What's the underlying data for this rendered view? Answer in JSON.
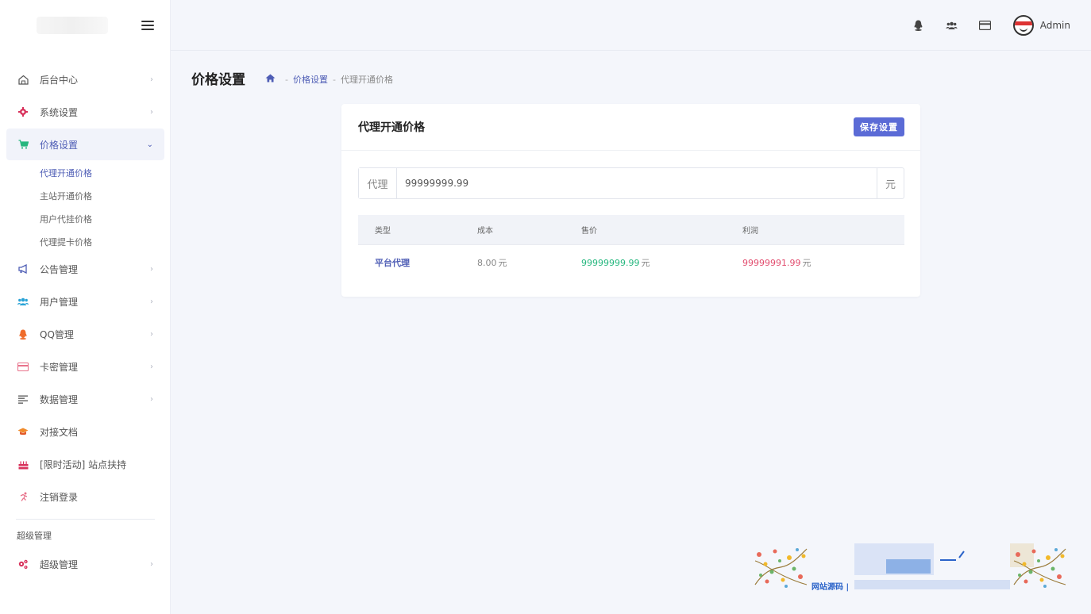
{
  "header": {
    "admin_name": "Admin"
  },
  "sidebar": {
    "items": [
      {
        "label": "后台中心",
        "icon": "home-icon"
      },
      {
        "label": "系统设置",
        "icon": "gear-icon"
      },
      {
        "label": "价格设置",
        "icon": "cart-icon",
        "active": true
      },
      {
        "label": "公告管理",
        "icon": "megaphone-icon"
      },
      {
        "label": "用户管理",
        "icon": "users-icon"
      },
      {
        "label": "QQ管理",
        "icon": "qq-icon"
      },
      {
        "label": "卡密管理",
        "icon": "card-icon"
      },
      {
        "label": "数据管理",
        "icon": "list-icon"
      },
      {
        "label": "对接文档",
        "icon": "graduation-cap-icon"
      },
      {
        "label": "[限时活动] 站点扶持",
        "icon": "birthday-cake-icon"
      },
      {
        "label": "注销登录",
        "icon": "running-icon"
      }
    ],
    "submenu": [
      {
        "label": "代理开通价格",
        "active": true
      },
      {
        "label": "主站开通价格"
      },
      {
        "label": "用户代挂价格"
      },
      {
        "label": "代理提卡价格"
      }
    ],
    "section_title": "超级管理",
    "super_item": {
      "label": "超级管理",
      "icon": "gears-icon"
    }
  },
  "page": {
    "title": "价格设置",
    "breadcrumb": {
      "sep1": "-",
      "link": "价格设置",
      "sep2": "-",
      "current": "代理开通价格"
    }
  },
  "card": {
    "title": "代理开通价格",
    "save_label": "保存设置",
    "input": {
      "prefix": "代理",
      "value": "99999999.99",
      "suffix": "元"
    },
    "table": {
      "headers": [
        "类型",
        "成本",
        "售价",
        "利润"
      ],
      "rows": [
        {
          "type": "平台代理",
          "cost": "8.00",
          "sale": "99999999.99",
          "profit": "99999991.99",
          "unit": "元"
        }
      ]
    }
  },
  "footer": {
    "banner_text": "网站源码 |"
  },
  "colors": {
    "accent": "#4e5db5",
    "button": "#5b6bd6",
    "sale": "#26b77f",
    "profit": "#e24d6f"
  }
}
